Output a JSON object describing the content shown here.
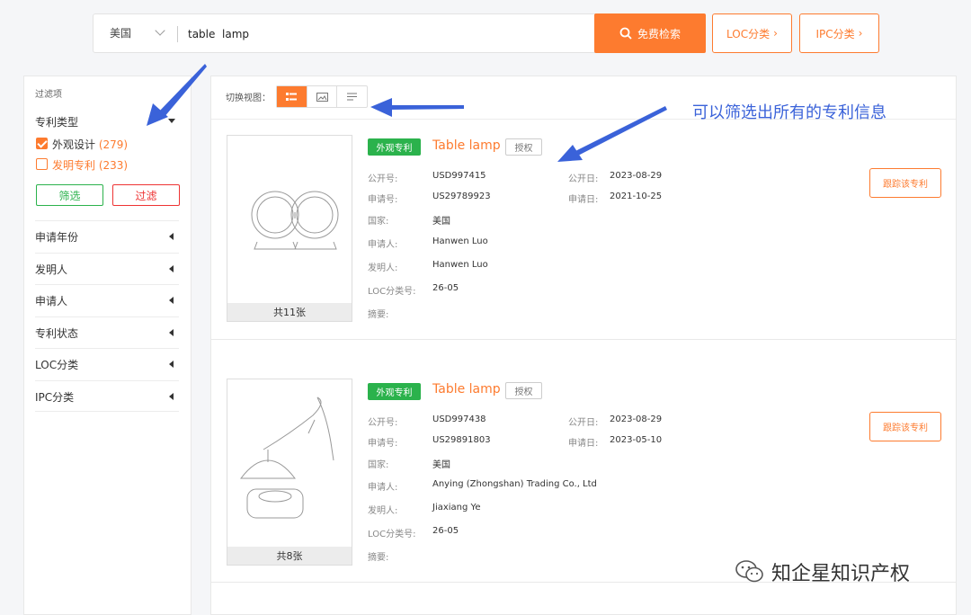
{
  "search": {
    "country": "美国",
    "query": "table  lamp",
    "search_label": "免费检索",
    "loc_label": "LOC分类",
    "ipc_label": "IPC分类"
  },
  "sidebar": {
    "title": "过滤项",
    "patent_type_label": "专利类型",
    "checks": [
      {
        "label": "外观设计",
        "count": "(279)",
        "checked": true
      },
      {
        "label": "发明专利",
        "count": "(233)",
        "checked": false
      }
    ],
    "filter_btn": "筛选",
    "exclude_btn": "过滤",
    "items": [
      "申请年份",
      "发明人",
      "申请人",
      "专利状态",
      "LOC分类",
      "IPC分类"
    ]
  },
  "view": {
    "label": "切换视图："
  },
  "field_labels": {
    "pub_no": "公开号:",
    "app_no": "申请号:",
    "country": "国家:",
    "applicant": "申请人:",
    "inventor": "发明人:",
    "loc": "LOC分类号:",
    "abstract": "摘要:",
    "pub_date": "公开日:",
    "app_date": "申请日:"
  },
  "results": [
    {
      "badge": "外观专利",
      "title": "Table lamp",
      "status": "授权",
      "pub_no": "USD997415",
      "app_no": "US29789923",
      "country": "美国",
      "applicant": "Hanwen Luo",
      "inventor": "Hanwen Luo",
      "loc": "26-05",
      "pub_date": "2023-08-29",
      "app_date": "2021-10-25",
      "image_count": "共11张",
      "track": "跟踪该专利"
    },
    {
      "badge": "外观专利",
      "title": "Table lamp",
      "status": "授权",
      "pub_no": "USD997438",
      "app_no": "US29891803",
      "country": "美国",
      "applicant": "Anying (Zhongshan) Trading Co., Ltd",
      "inventor": "Jiaxiang Ye",
      "loc": "26-05",
      "pub_date": "2023-08-29",
      "app_date": "2023-05-10",
      "image_count": "共8张",
      "track": "跟踪该专利"
    }
  ],
  "annotation": "可以筛选出所有的专利信息",
  "watermark": "知企星知识产权",
  "colors": {
    "accent": "#fd7b2f",
    "green": "#2bb24c",
    "red": "#e33333",
    "arrow": "#3a62d9"
  }
}
